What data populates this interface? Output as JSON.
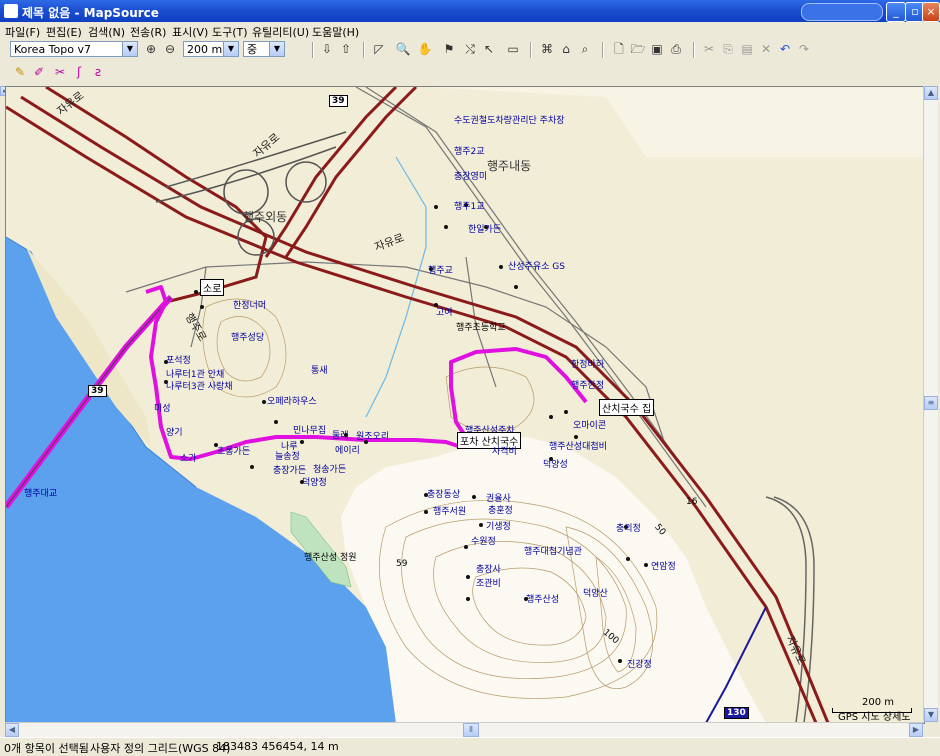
{
  "window": {
    "title": "제목 없음 - MapSource"
  },
  "menu": [
    "파일(F)",
    "편집(E)",
    "검색(N)",
    "전송(R)",
    "표시(V)",
    "도구(T)",
    "유틸리티(U)",
    "도움말(H)"
  ],
  "toolbar": {
    "map_product": "Korea Topo v7",
    "zoom_scale": "200 m",
    "detail": "중"
  },
  "map": {
    "labels": [
      {
        "t": "자유로",
        "c": "road"
      },
      {
        "t": "39",
        "c": "shield"
      },
      {
        "t": "수도권철도차량관리단 주차장",
        "c": ""
      },
      {
        "t": "행주2교",
        "c": ""
      },
      {
        "t": "행주내동",
        "c": "bigplace"
      },
      {
        "t": "충장영미",
        "c": ""
      },
      {
        "t": "자유로",
        "c": "road"
      },
      {
        "t": "행주외동",
        "c": "bigplace"
      },
      {
        "t": "행주1교",
        "c": ""
      },
      {
        "t": "한일가든",
        "c": ""
      },
      {
        "t": "자유로",
        "c": "road"
      },
      {
        "t": "행주교",
        "c": ""
      },
      {
        "t": "산성주유소 GS",
        "c": ""
      },
      {
        "t": "소로",
        "c": "box"
      },
      {
        "t": "한정너머",
        "c": ""
      },
      {
        "t": "고여",
        "c": ""
      },
      {
        "t": "행주초등학교",
        "c": "dark"
      },
      {
        "t": "행주성당",
        "c": ""
      },
      {
        "t": "행주로",
        "c": "road"
      },
      {
        "t": "39",
        "c": "shield"
      },
      {
        "t": "포석정",
        "c": ""
      },
      {
        "t": "나루터1관 안채",
        "c": ""
      },
      {
        "t": "나루터3관 사랑채",
        "c": ""
      },
      {
        "t": "통새",
        "c": ""
      },
      {
        "t": "오페라하우스",
        "c": ""
      },
      {
        "t": "미성",
        "c": ""
      },
      {
        "t": "양기",
        "c": ""
      },
      {
        "t": "행주산성주차",
        "c": ""
      },
      {
        "t": "산치국수 집",
        "c": "box"
      },
      {
        "t": "행주한정",
        "c": ""
      },
      {
        "t": "한정바하",
        "c": ""
      },
      {
        "t": "오마이콘",
        "c": ""
      },
      {
        "t": "민나무집",
        "c": ""
      },
      {
        "t": "둘레",
        "c": ""
      },
      {
        "t": "원조오리",
        "c": ""
      },
      {
        "t": "포차 산치국수",
        "c": "box"
      },
      {
        "t": "에이리",
        "c": ""
      },
      {
        "t": "사격비",
        "c": ""
      },
      {
        "t": "나루",
        "c": ""
      },
      {
        "t": "소가",
        "c": ""
      },
      {
        "t": "초롱가든",
        "c": ""
      },
      {
        "t": "늘송정",
        "c": ""
      },
      {
        "t": "덕양성",
        "c": ""
      },
      {
        "t": "충장가든",
        "c": ""
      },
      {
        "t": "청송가든",
        "c": ""
      },
      {
        "t": "덕양정",
        "c": ""
      },
      {
        "t": "행주산성대첩비",
        "c": ""
      },
      {
        "t": "충장동상",
        "c": ""
      },
      {
        "t": "권율사",
        "c": ""
      },
      {
        "t": "행주서원",
        "c": ""
      },
      {
        "t": "충훈정",
        "c": ""
      },
      {
        "t": "기생정",
        "c": ""
      },
      {
        "t": "수원정",
        "c": ""
      },
      {
        "t": "행주산성 정원",
        "c": "dark"
      },
      {
        "t": "행주대첩기념관",
        "c": ""
      },
      {
        "t": "59",
        "c": "dark"
      },
      {
        "t": "충의정",
        "c": ""
      },
      {
        "t": "충장사",
        "c": ""
      },
      {
        "t": "조관비",
        "c": ""
      },
      {
        "t": "행주산성",
        "c": ""
      },
      {
        "t": "덕양산",
        "c": ""
      },
      {
        "t": "연암정",
        "c": ""
      },
      {
        "t": "16",
        "c": "dark"
      },
      {
        "t": "50",
        "c": "dark"
      },
      {
        "t": "100",
        "c": "dark"
      },
      {
        "t": "자유로",
        "c": "road"
      },
      {
        "t": "진강정",
        "c": ""
      },
      {
        "t": "행주대교",
        "c": ""
      },
      {
        "t": "130",
        "c": "shield"
      }
    ],
    "scale_label": "200 m",
    "scale_detail": "GPS 지노 상세도"
  },
  "status": {
    "selection": "0개 항목이 선택됨",
    "grid": "사용자 정의 그리드(WGS 84)",
    "coords": "183483 456454, 14 m"
  },
  "icons": {
    "app": "mapsource-app-icon",
    "zoom_in": "zoom-in-icon",
    "zoom_out": "zoom-out-icon",
    "hand": "pan-hand-icon",
    "find": "binoculars-icon"
  },
  "colors": {
    "water": "#5CA1EE",
    "land": "#F2EDD6",
    "hill": "#FBF9F1",
    "route": "#E010E0",
    "highway": "#8B1A1A",
    "contour": "#B89A6A"
  }
}
